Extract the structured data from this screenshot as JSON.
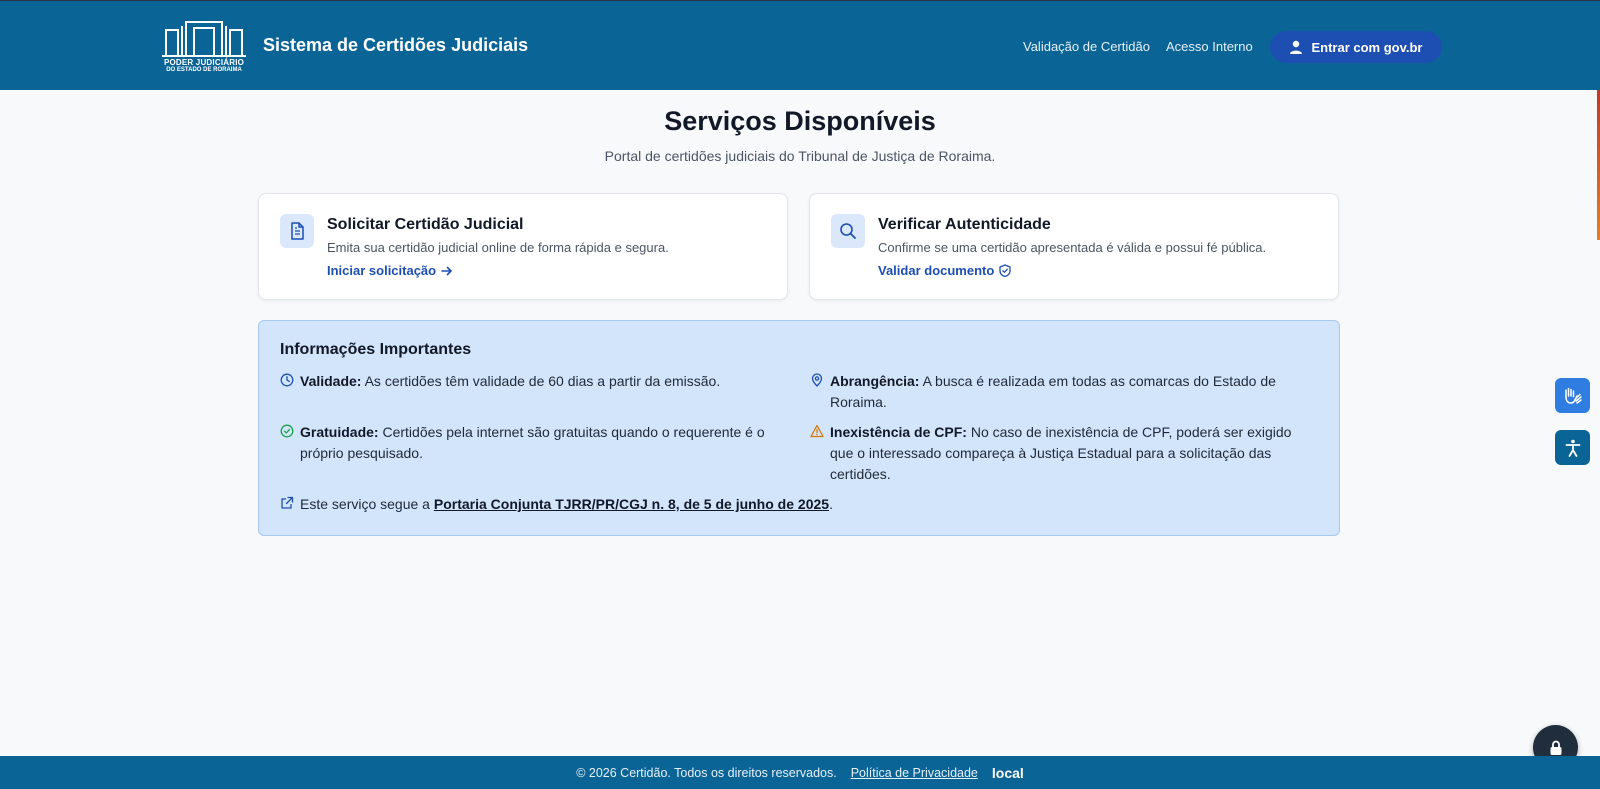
{
  "header": {
    "logo_line1": "PODER JUDICIÁRIO",
    "logo_line2": "DO ESTADO DE RORAIMA",
    "app_title": "Sistema de Certidões Judiciais",
    "nav": {
      "validacao": "Validação de Certidão",
      "acesso": "Acesso Interno"
    },
    "login_button": "Entrar com gov.br"
  },
  "main": {
    "title": "Serviços Disponíveis",
    "subtitle": "Portal de certidões judiciais do Tribunal de Justiça de Roraima.",
    "cards": [
      {
        "icon": "document-icon",
        "title": "Solicitar Certidão Judicial",
        "description": "Emita sua certidão judicial online de forma rápida e segura.",
        "link": "Iniciar solicitação"
      },
      {
        "icon": "search-icon",
        "title": "Verificar Autenticidade",
        "description": "Confirme se uma certidão apresentada é válida e possui fé pública.",
        "link": "Validar documento"
      }
    ],
    "info": {
      "title": "Informações Importantes",
      "items": [
        {
          "label": "Validade:",
          "text": "As certidões têm validade de 60 dias a partir da emissão.",
          "icon": "clock-icon"
        },
        {
          "label": "Abrangência:",
          "text": "A busca é realizada em todas as comarcas do Estado de Roraima.",
          "icon": "map-pin-icon"
        },
        {
          "label": "Gratuidade:",
          "text": "Certidões pela internet são gratuitas quando o requerente é o próprio pesquisado.",
          "icon": "check-circle-icon"
        },
        {
          "label": "Inexistência de CPF:",
          "text": "No caso de inexistência de CPF, poderá ser exigido que o interessado compareça à Justiça Estadual para a solicitação das certidões.",
          "icon": "warning-icon"
        }
      ],
      "portaria_prefix": "Este serviço segue a",
      "portaria_link": "Portaria Conjunta TJRR/PR/CGJ n. 8, de 5 de junho de 2025",
      "portaria_suffix": "."
    }
  },
  "footer": {
    "copyright": "© 2026 Certidão. Todos os direitos reservados.",
    "privacy": "Política de Privacidade",
    "env": "local"
  },
  "colors": {
    "header_bg": "#0b6496",
    "accent": "#1d4fb3",
    "info_bg": "#d3e5fb"
  }
}
